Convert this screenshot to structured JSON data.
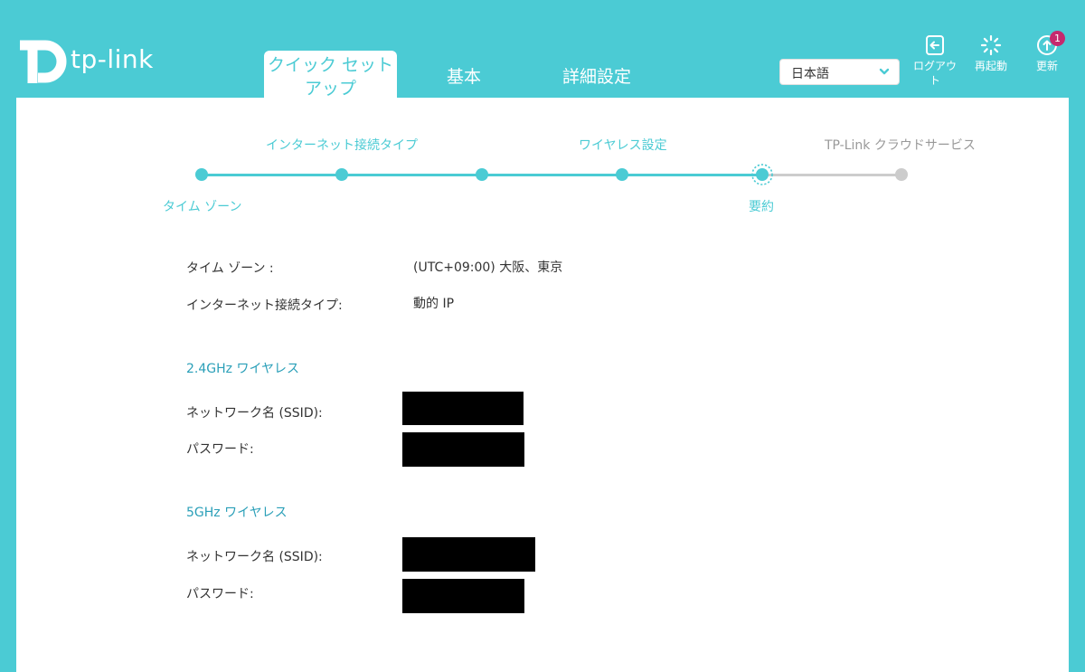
{
  "brand": {
    "name": "tp-link"
  },
  "nav": {
    "tabs": [
      {
        "label_line1": "クイック セット",
        "label_line2": "アップ",
        "active": true
      },
      {
        "label": "基本"
      },
      {
        "label": "詳細設定"
      }
    ]
  },
  "language": {
    "selected": "日本語"
  },
  "header_buttons": {
    "logout": {
      "label_line1": "ログアウ",
      "label_line2": "ト",
      "icon": "logout-icon"
    },
    "reboot": {
      "label": "再起動",
      "icon": "reboot-icon"
    },
    "update": {
      "label": "更新",
      "icon": "update-icon",
      "badge": "1"
    }
  },
  "progress": {
    "steps_top": [
      "インターネット接続タイプ",
      "ワイヤレス設定",
      "TP-Link クラウドサービス"
    ],
    "steps_bottom": [
      "タイム ゾーン",
      "要約"
    ],
    "current_step": "要約",
    "active_color": "#4bcbd4",
    "inactive_color": "#cccccc"
  },
  "summary": {
    "timezone_label": "タイム ゾーン :",
    "timezone_value": "(UTC+09:00) 大阪、東京",
    "conn_type_label": "インターネット接続タイプ:",
    "conn_type_value": "動的 IP",
    "wifi24": {
      "title": "2.4GHz ワイヤレス",
      "ssid_label": "ネットワーク名 (SSID):",
      "password_label": "パスワード:"
    },
    "wifi5": {
      "title": "5GHz ワイヤレス",
      "ssid_label": "ネットワーク名 (SSID):",
      "password_label": "パスワード:"
    }
  }
}
